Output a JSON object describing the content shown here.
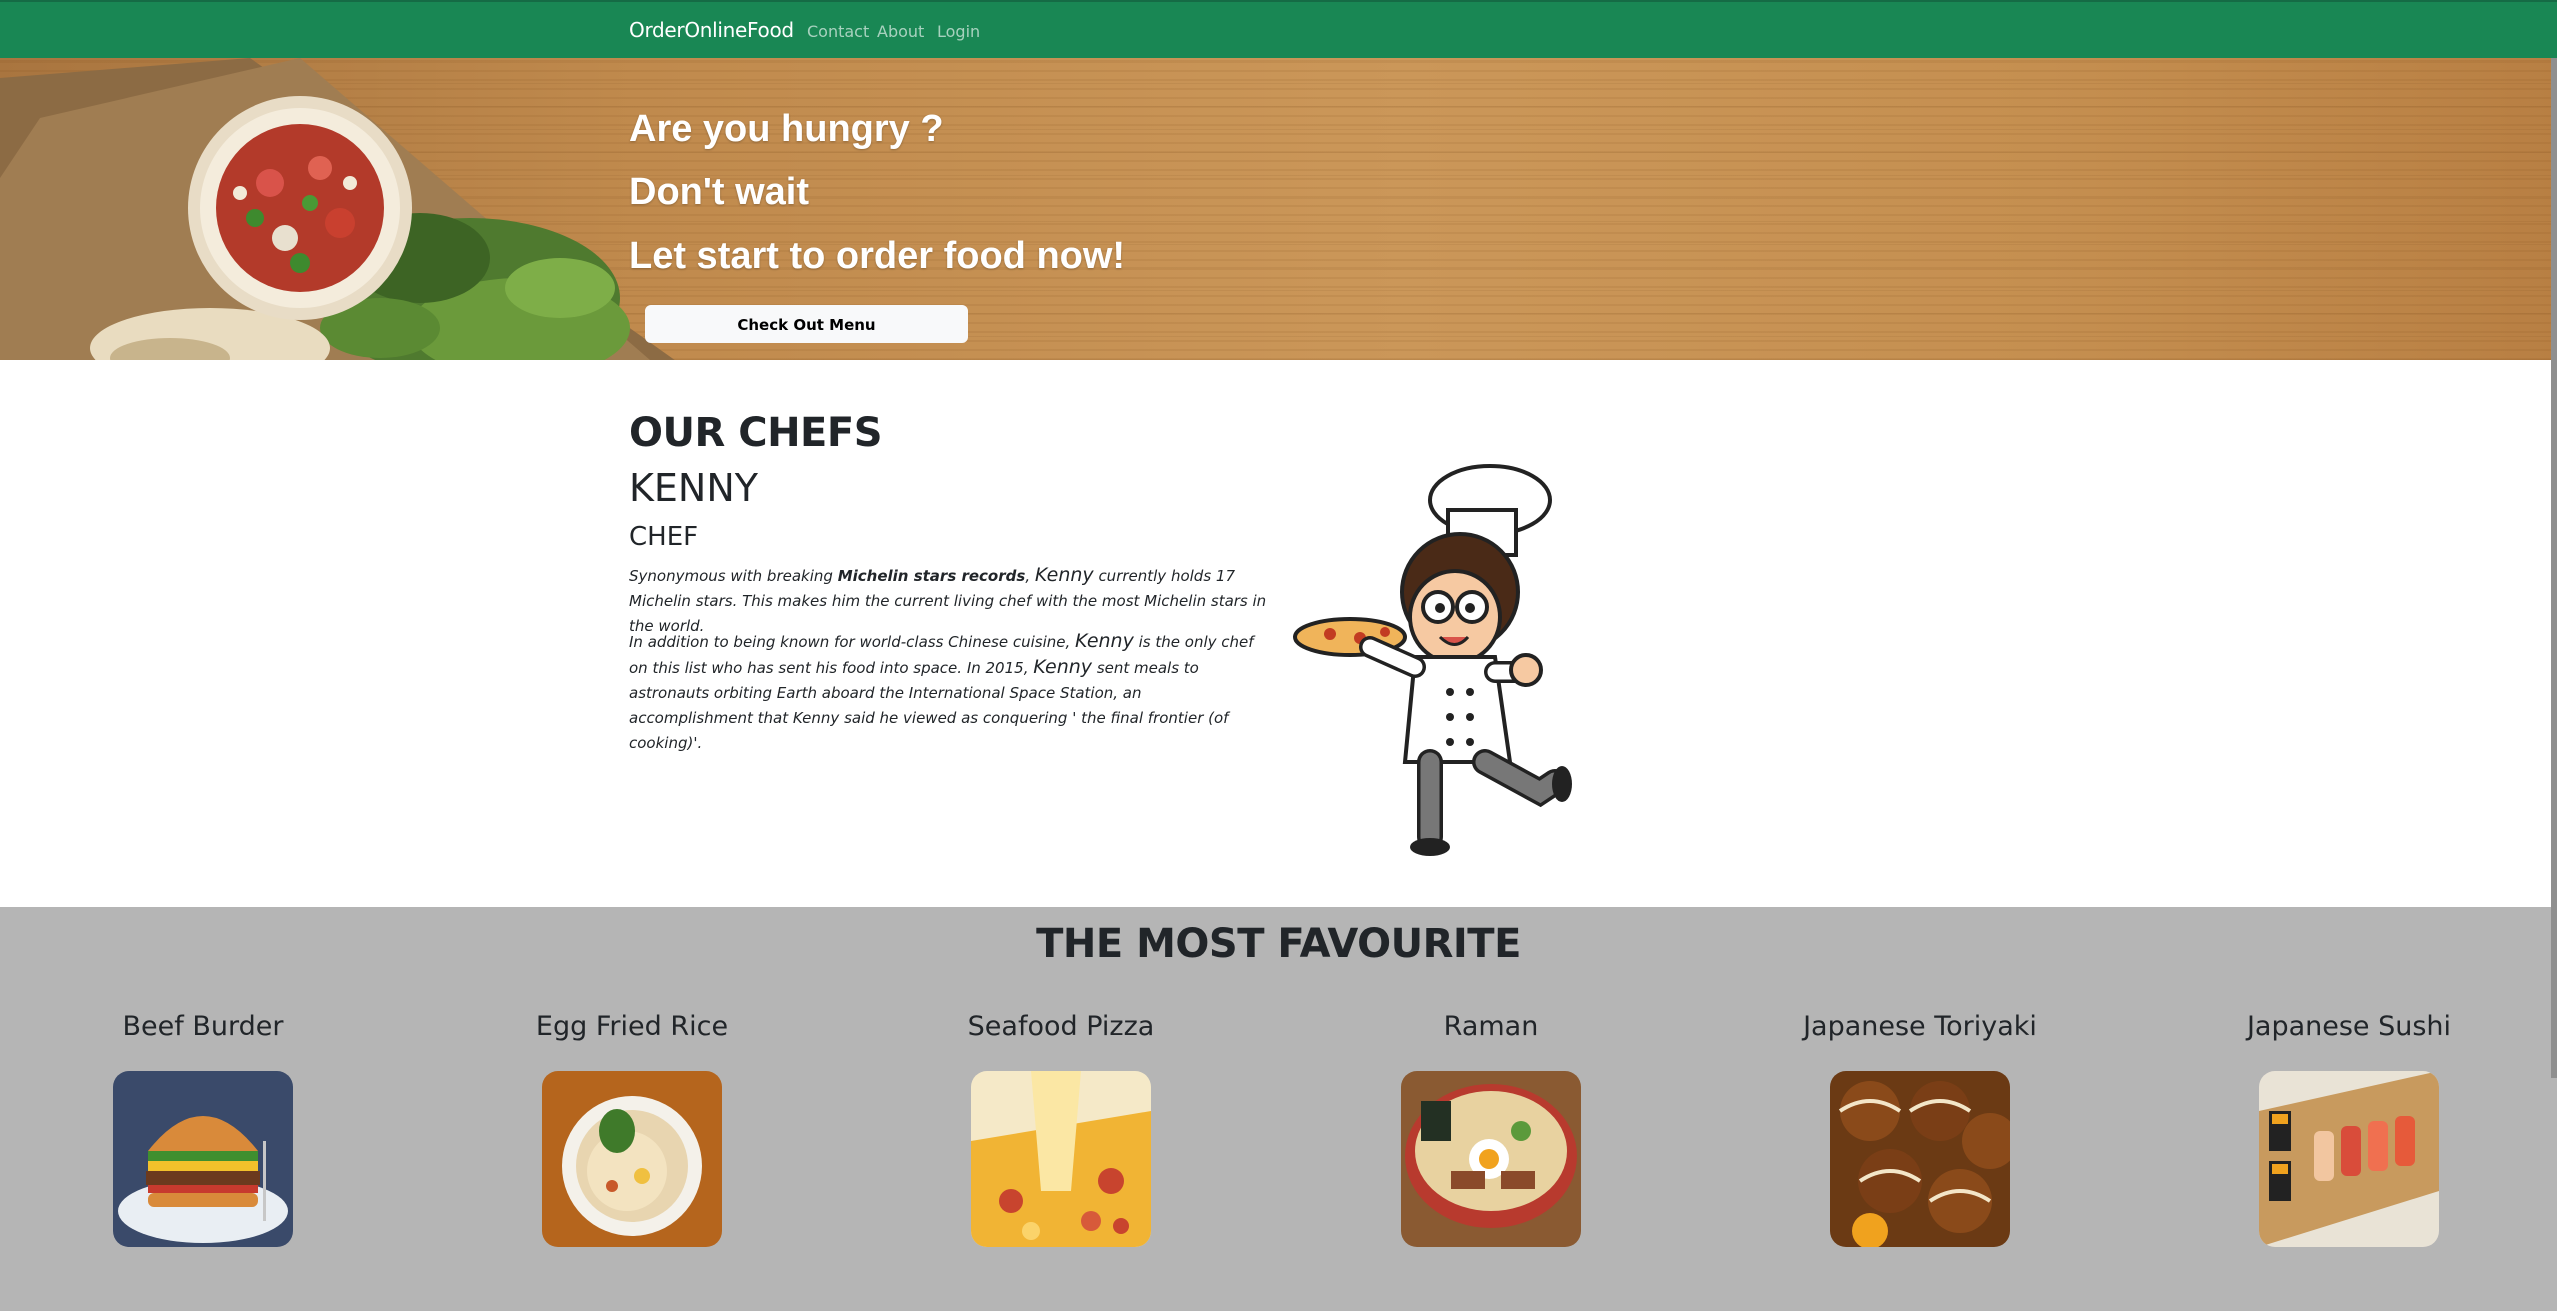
{
  "navbar": {
    "brand": "OrderOnlineFood",
    "links": [
      "Contact",
      "About",
      "Login"
    ],
    "color": "#198754"
  },
  "hero": {
    "line1": "Are you hungry ?",
    "line2": "Don't wait",
    "line3": "Let start to order food now!",
    "button": "Check Out Menu"
  },
  "chefs": {
    "heading": "OUR CHEFS",
    "name": "KENNY",
    "role": "CHEF",
    "p1_a": "Synonymous with breaking ",
    "p1_bold": "Michelin stars records",
    "p1_b": ", ",
    "p1_name": "Kenny",
    "p1_c": " currently holds 17 Michelin stars. This makes him the current living chef with the most Michelin stars in the world.",
    "p2_a": "In addition to being known for world-class Chinese cuisine, ",
    "p2_name1": "Kenny",
    "p2_b": " is the only chef on this list who has sent his food into space. In 2015, ",
    "p2_name2": "Kenny",
    "p2_c": " sent meals to astronauts orbiting Earth aboard the International Space Station, an accomplishment that Kenny said he viewed as conquering ' the final frontier (of cooking)'."
  },
  "favourites": {
    "title": "THE MOST FAVOURITE",
    "items": [
      {
        "name": "Beef Burder",
        "icon": "burger-image"
      },
      {
        "name": "Egg Fried Rice",
        "icon": "fried-rice-image"
      },
      {
        "name": "Seafood Pizza",
        "icon": "pizza-image"
      },
      {
        "name": "Raman",
        "icon": "ramen-image"
      },
      {
        "name": "Japanese Toriyaki",
        "icon": "takoyaki-image"
      },
      {
        "name": "Japanese Sushi",
        "icon": "sushi-image"
      }
    ],
    "background": "#b5b5b5"
  }
}
